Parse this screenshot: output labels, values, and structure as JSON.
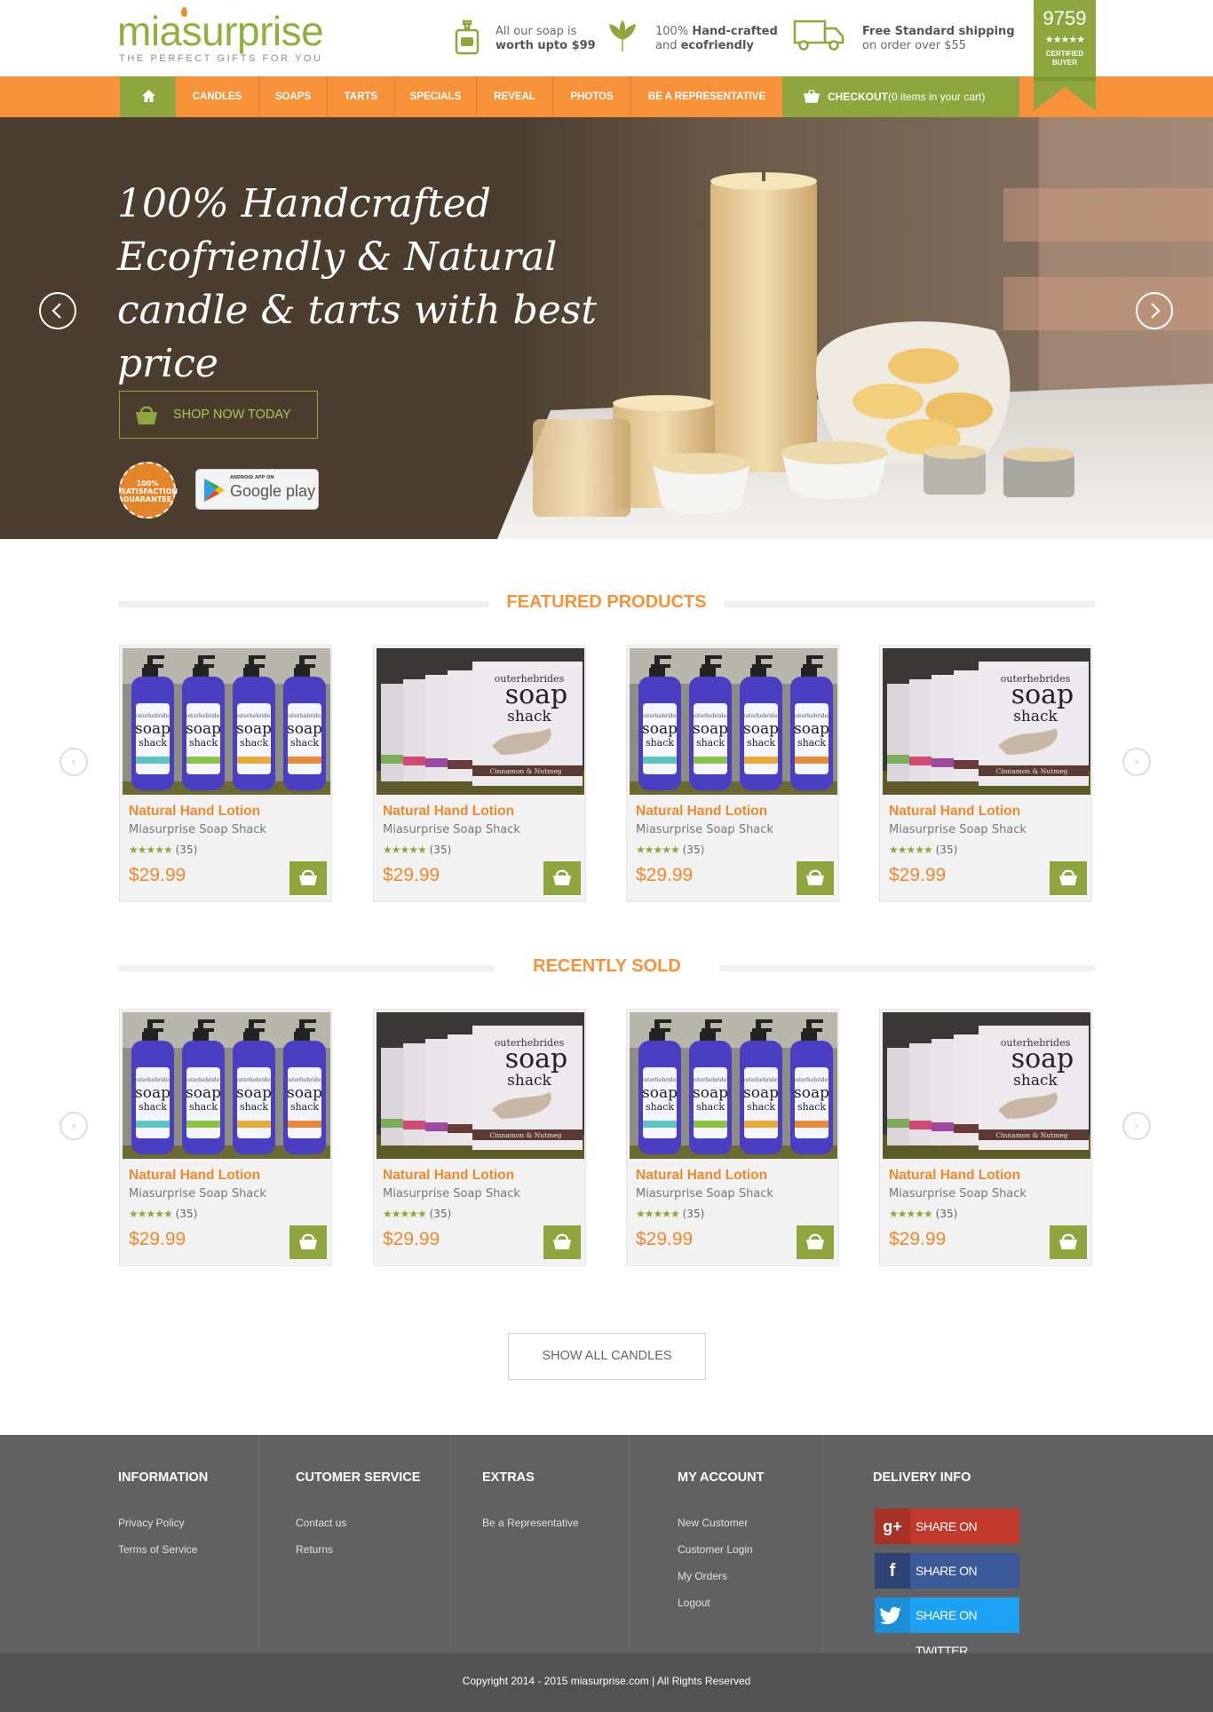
{
  "header": {
    "logo": "miasurprise",
    "tagline": "THE PERFECT GIFTS FOR YOU",
    "features": [
      {
        "icon": "soap-dispenser-icon",
        "line1": "All our soap is",
        "line2": "worth upto $99"
      },
      {
        "icon": "leaf-icon",
        "line1_pre": "100% ",
        "line1_bold": "Hand-crafted",
        "line2_pre": "and ",
        "line2_bold": "ecofriendly"
      },
      {
        "icon": "truck-icon",
        "line1": "Free Standard shipping",
        "line2": "on order over $55"
      }
    ],
    "badge": {
      "number": "9759",
      "stars": "★★★★★",
      "line1": "CERTIFIED",
      "line2": "BUYER"
    }
  },
  "nav": {
    "home_icon": "home-icon",
    "items": [
      "CANDLES",
      "SOAPS",
      "TARTS",
      "SPECIALS",
      "REVEAL",
      "PHOTOS",
      "BE A REPRESENTATIVE"
    ],
    "checkout_label": "CHECKOUT",
    "checkout_note": "(0 items in your cart)"
  },
  "hero": {
    "line1": "100% Handcrafted",
    "line2": "Ecofriendly & Natural",
    "line3": "candle & tarts with best price",
    "shop_button": "SHOP NOW TODAY",
    "seal_text": "100% SATISFACTION GUARANTEE",
    "gplay_small": "ANDROID APP ON",
    "gplay_label": "Google play"
  },
  "featured": {
    "title": "FEATURED PRODUCTS",
    "products": [
      {
        "name": "Natural Hand Lotion",
        "brand": "Miasurprise Soap Shack",
        "stars": "★★★★★",
        "reviews": "(35)",
        "price": "$29.99",
        "image": "lotion"
      },
      {
        "name": "Natural Hand Lotion",
        "brand": "Miasurprise Soap Shack",
        "stars": "★★★★★",
        "reviews": "(35)",
        "price": "$29.99",
        "image": "soap"
      },
      {
        "name": "Natural Hand Lotion",
        "brand": "Miasurprise Soap Shack",
        "stars": "★★★★★",
        "reviews": "(35)",
        "price": "$29.99",
        "image": "lotion"
      },
      {
        "name": "Natural Hand Lotion",
        "brand": "Miasurprise Soap Shack",
        "stars": "★★★★★",
        "reviews": "(35)",
        "price": "$29.99",
        "image": "soap"
      }
    ]
  },
  "recent": {
    "title": "RECENTLY SOLD",
    "products": [
      {
        "name": "Natural Hand Lotion",
        "brand": "Miasurprise Soap Shack",
        "stars": "★★★★★",
        "reviews": "(35)",
        "price": "$29.99",
        "image": "lotion"
      },
      {
        "name": "Natural Hand Lotion",
        "brand": "Miasurprise Soap Shack",
        "stars": "★★★★★",
        "reviews": "(35)",
        "price": "$29.99",
        "image": "soap"
      },
      {
        "name": "Natural Hand Lotion",
        "brand": "Miasurprise Soap Shack",
        "stars": "★★★★★",
        "reviews": "(35)",
        "price": "$29.99",
        "image": "lotion"
      },
      {
        "name": "Natural Hand Lotion",
        "brand": "Miasurprise Soap Shack",
        "stars": "★★★★★",
        "reviews": "(35)",
        "price": "$29.99",
        "image": "soap"
      }
    ]
  },
  "show_all": "SHOW ALL CANDLES",
  "soap_label": {
    "top": "outerhebrides",
    "main": "soap",
    "sub": "shack",
    "scent": "Cinnamon & Nutmeg"
  },
  "footer": {
    "columns": [
      {
        "heading": "INFORMATION",
        "links": [
          "Privacy Policy",
          "Terms of Service"
        ]
      },
      {
        "heading": "CUTOMER SERVICE",
        "links": [
          "Contact us",
          "Returns"
        ]
      },
      {
        "heading": "EXTRAS",
        "links": [
          "Be a Representative"
        ]
      },
      {
        "heading": "MY ACCOUNT",
        "links": [
          "New Customer",
          "Customer Login",
          "My Orders",
          "Logout"
        ]
      },
      {
        "heading": "DELIVERY INFO",
        "links": []
      }
    ],
    "share": [
      {
        "icon": "google-plus-icon",
        "glyph": "g+",
        "label": "SHARE ON GOOGLE+",
        "color": "#c0392b",
        "icon_color": "#a93226"
      },
      {
        "icon": "facebook-icon",
        "glyph": "f",
        "label": "SHARE ON FACEBOOK",
        "color": "#3b5998",
        "icon_color": "#2d4373"
      },
      {
        "icon": "twitter-icon",
        "glyph": "t",
        "label": "SHARE ON TWITTER",
        "color": "#1da1f2",
        "icon_color": "#1a8fd8"
      }
    ],
    "copyright": "Copyright 2014 - 2015 miasurprise.com  |  All Rights Reserved"
  },
  "colors": {
    "orange": "#f7923a",
    "green": "#8ea63d",
    "hero_bg": "#4b3e2e",
    "footer_bg": "#616161"
  }
}
